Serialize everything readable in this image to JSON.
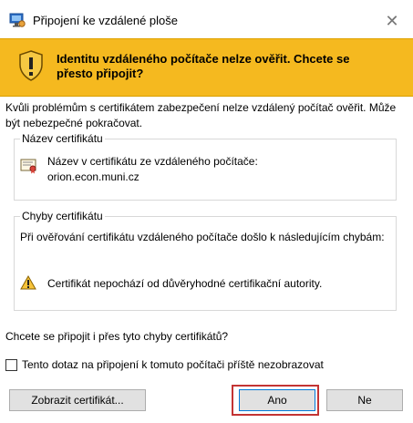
{
  "window": {
    "title": "Připojení ke vzdálené ploše",
    "close_glyph": "✕"
  },
  "banner": {
    "text": "Identitu vzdáleného počítače nelze ověřit. Chcete se přesto připojit?",
    "color": "#f5b91f"
  },
  "intro": "Kvůli problémům s certifikátem zabezpečení nelze vzdálený počítač ověřit. Může být nebezpečné pokračovat.",
  "certificate_name": {
    "legend": "Název certifikátu",
    "label": "Název v certifikátu ze vzdáleného počítače:",
    "value": "orion.econ.muni.cz"
  },
  "certificate_errors": {
    "legend": "Chyby certifikátu",
    "description": "Při ověřování certifikátu vzdáleného počítače došlo k následujícím chybám:",
    "errors": [
      "Certifikát nepochází od důvěryhodné certifikační autority."
    ]
  },
  "question": "Chcete se připojit i přes tyto chyby certifikátů?",
  "checkbox": {
    "label": "Tento dotaz na připojení k tomuto počítači příště nezobrazovat",
    "checked": false
  },
  "buttons": {
    "show_certificate": "Zobrazit certifikát...",
    "yes": "Ano",
    "no": "Ne"
  },
  "colors": {
    "highlight_frame": "#c33434",
    "default_button_border": "#0078d7"
  }
}
